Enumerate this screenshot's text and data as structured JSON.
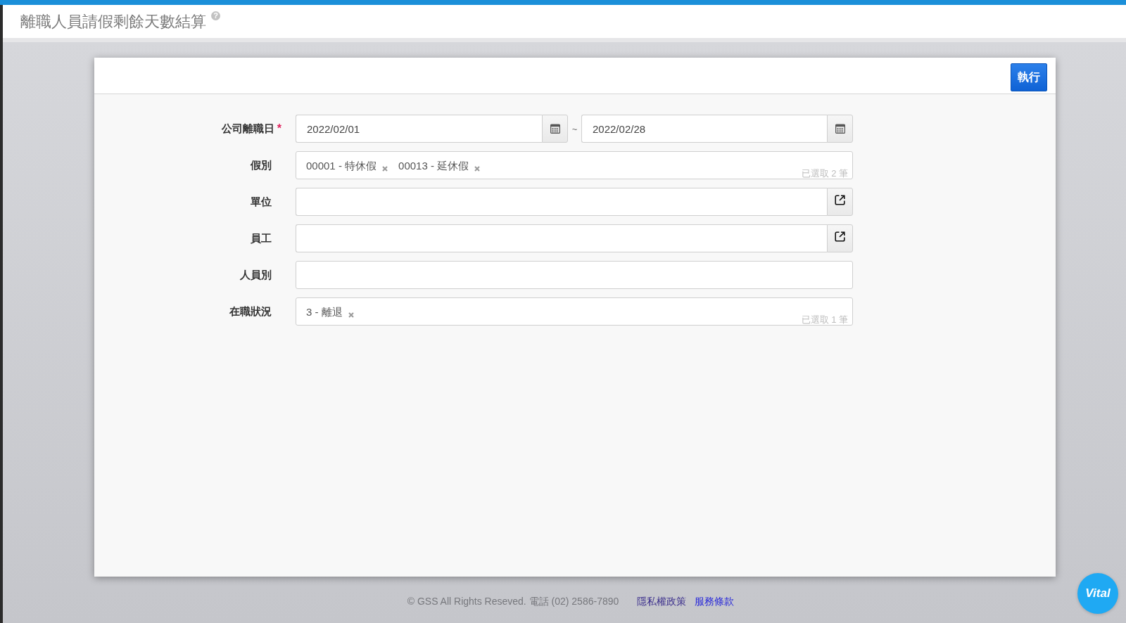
{
  "window": {
    "title": "離職人員請假剩餘天數結算",
    "help": "?"
  },
  "toolbar": {
    "buttons": [
      {
        "label": "執行"
      }
    ]
  },
  "form": {
    "fields": [
      {
        "kind": "date_range",
        "label": "公司離職日",
        "required_mark": "*",
        "from": "2022/02/01",
        "separator": "~",
        "to": "2022/02/28"
      },
      {
        "kind": "tags",
        "label": "假別",
        "tags": [
          "00001 - 特休假",
          "00013 - 延休假"
        ],
        "count": "已選取 2 筆"
      },
      {
        "kind": "lookup",
        "label": "單位"
      },
      {
        "kind": "lookup",
        "label": "員工"
      },
      {
        "kind": "text",
        "label": "人員別"
      },
      {
        "kind": "tags",
        "label": "在職狀況",
        "tags": [
          "3 - 離退"
        ],
        "count": "已選取 1 筆"
      }
    ]
  },
  "footer": {
    "copyright": "© GSS All Rights Reseved. 電話 (02) 2586-7890",
    "links": [
      {
        "label": "隱私權政策",
        "visited": true
      },
      {
        "label": "服務條款",
        "visited": false
      }
    ]
  },
  "floating_badge": {
    "label": "Vital"
  }
}
